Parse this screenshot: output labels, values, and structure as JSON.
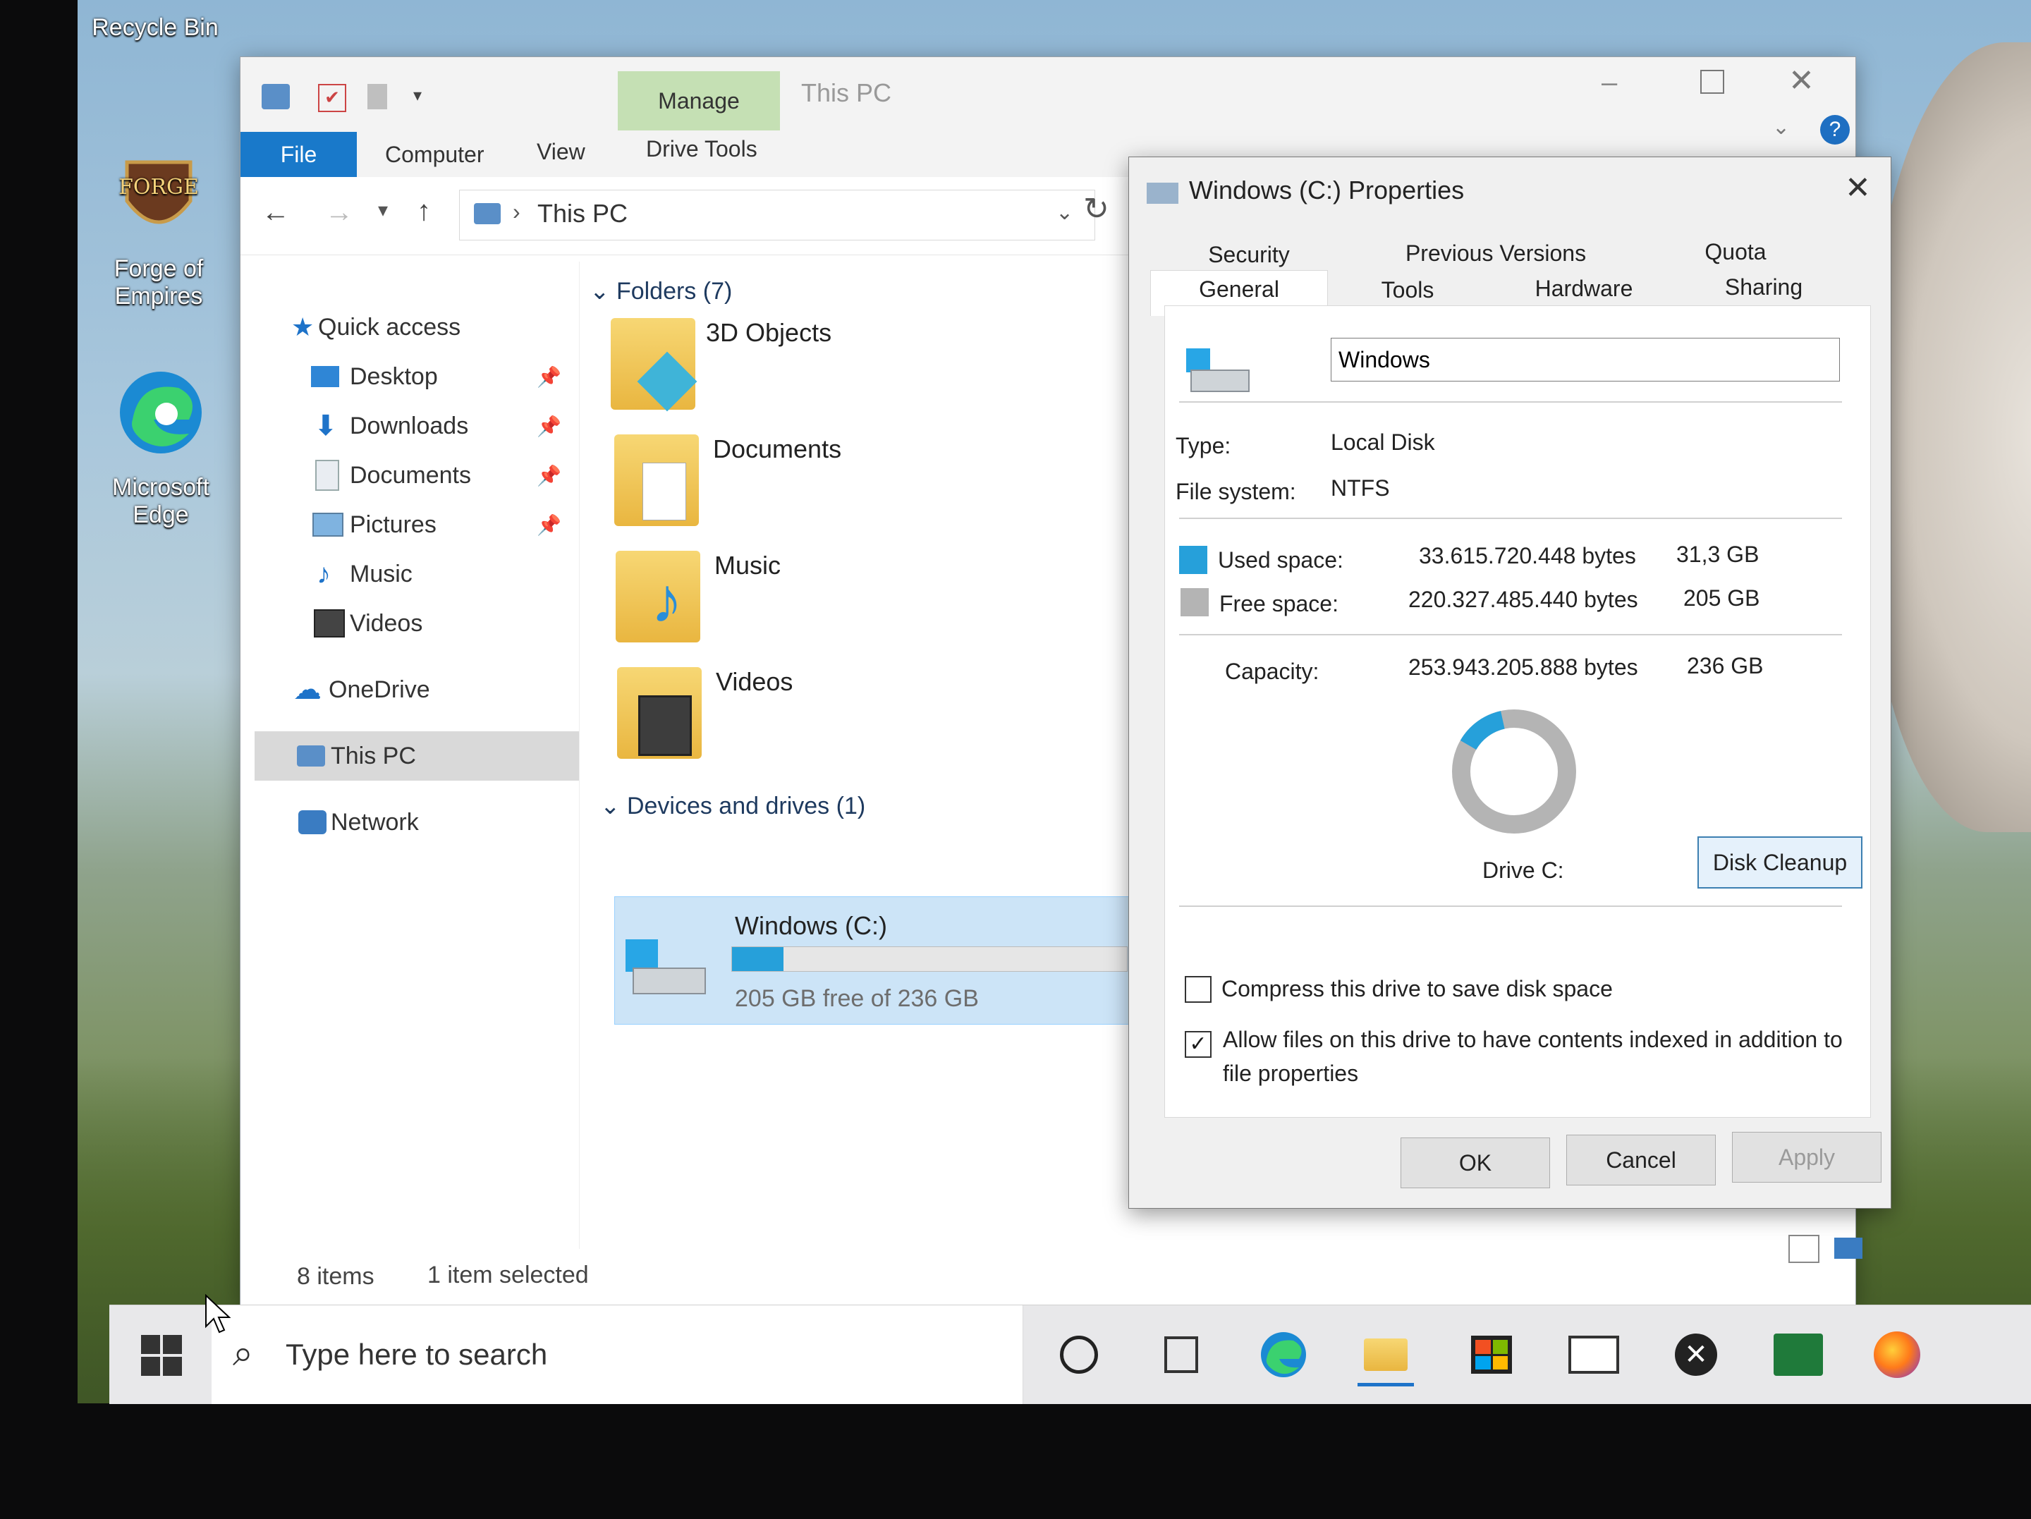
{
  "desktop": {
    "icons": [
      {
        "label": "Recycle Bin"
      },
      {
        "label": "Forge of Empires"
      },
      {
        "label": "Microsoft Edge"
      }
    ]
  },
  "explorer": {
    "title": "This PC",
    "ribbon_tabs": {
      "file": "File",
      "computer": "Computer",
      "view": "View",
      "manage": "Manage",
      "drive_tools": "Drive Tools"
    },
    "address": {
      "location": "This PC"
    },
    "nav": {
      "quick_access": "Quick access",
      "items": [
        "Desktop",
        "Downloads",
        "Documents",
        "Pictures",
        "Music",
        "Videos"
      ],
      "onedrive": "OneDrive",
      "this_pc": "This PC",
      "network": "Network"
    },
    "content": {
      "folders_header": "Folders (7)",
      "folders": [
        "3D Objects",
        "Documents",
        "Music",
        "Videos"
      ],
      "devices_header": "Devices and drives (1)",
      "drive": {
        "name": "Windows (C:)",
        "free_text": "205 GB free of 236 GB",
        "used_fraction": 0.13
      }
    },
    "status": {
      "items": "8 items",
      "selected": "1 item selected"
    }
  },
  "properties": {
    "title": "Windows (C:) Properties",
    "tabs_row1": [
      "Security",
      "Previous Versions",
      "Quota"
    ],
    "tabs_row2": [
      "General",
      "Tools",
      "Hardware",
      "Sharing"
    ],
    "volume_name": "Windows",
    "type_label": "Type:",
    "type_value": "Local Disk",
    "fs_label": "File system:",
    "fs_value": "NTFS",
    "used_label": "Used space:",
    "used_bytes": "33.615.720.448 bytes",
    "used_gb": "31,3 GB",
    "free_label": "Free space:",
    "free_bytes": "220.327.485.440 bytes",
    "free_gb": "205 GB",
    "capacity_label": "Capacity:",
    "capacity_bytes": "253.943.205.888 bytes",
    "capacity_gb": "236 GB",
    "used_fraction": 0.132,
    "drive_label": "Drive C:",
    "disk_cleanup": "Disk Cleanup",
    "compress_label": "Compress this drive to save disk space",
    "compress_checked": false,
    "index_label_1": "Allow files on this drive to have contents indexed in addition to",
    "index_label_2": "file properties",
    "index_checked": true,
    "ok": "OK",
    "cancel": "Cancel",
    "apply": "Apply",
    "colors": {
      "used": "#26a0da",
      "free": "#b4b4b4"
    }
  },
  "taskbar": {
    "search_placeholder": "Type here to search"
  }
}
